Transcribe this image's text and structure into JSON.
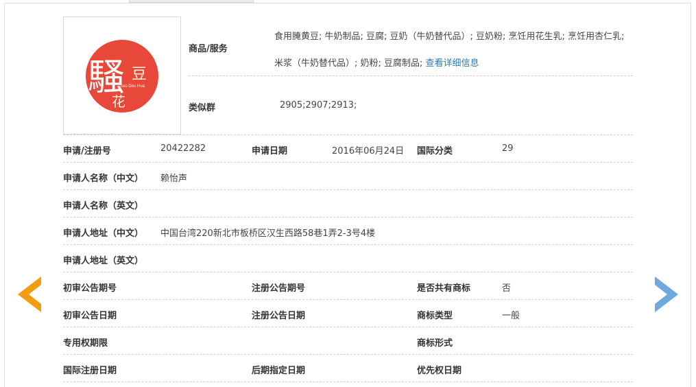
{
  "logo": {
    "main_char": "騷",
    "char_dou": "豆",
    "char_hua": "花",
    "pinyin": "Sao Dou Hua",
    "red": "#e8483a"
  },
  "goods": {
    "label": "商品/服务",
    "text": "食用腌黄豆; 牛奶制品; 豆腐; 豆奶（牛奶替代品）; 豆奶粉; 烹饪用花生乳; 烹饪用杏仁乳; 米浆（牛奶替代品）; 奶粉; 豆腐制品;",
    "link": "查看详细信息"
  },
  "similar": {
    "label": "类似群",
    "value": "2905;2907;2913;"
  },
  "reg": {
    "no_label": "申请/注册号",
    "no_value": "20422282",
    "date_label": "申请日期",
    "date_value": "2016年06月24日",
    "class_label": "国际分类",
    "class_value": "29"
  },
  "applicant_cn": {
    "label": "申请人名称（中文）",
    "value": "赖怡声"
  },
  "applicant_en": {
    "label": "申请人名称（英文）",
    "value": ""
  },
  "address_cn": {
    "label": "申请人地址（中文）",
    "value": "中国台湾220新北市板桥区汉生西路58巷1弄2-3号4楼"
  },
  "address_en": {
    "label": "申请人地址（英文）",
    "value": ""
  },
  "row_a": {
    "l1": "初审公告期号",
    "v1": "",
    "l2": "注册公告期号",
    "v2": "",
    "l3": "是否共有商标",
    "v3": "否"
  },
  "row_b": {
    "l1": "初审公告日期",
    "v1": "",
    "l2": "注册公告日期",
    "v2": "",
    "l3": "商标类型",
    "v3": "一般"
  },
  "row_c": {
    "l1": "专用权期限",
    "v1": "",
    "l3": "商标形式",
    "v3": ""
  },
  "row_d": {
    "l1": "国际注册日期",
    "v1": "",
    "l2": "后期指定日期",
    "v2": "",
    "l3": "优先权日期",
    "v3": ""
  },
  "nav": {
    "prev_color": "#f39c12",
    "next_color": "#6fa8dc"
  }
}
